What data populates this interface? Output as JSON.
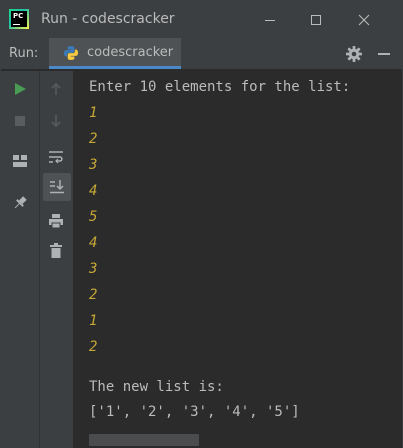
{
  "window": {
    "title": "Run - codescracker"
  },
  "run_panel": {
    "label": "Run:",
    "tab_label": "codescracker"
  },
  "console": {
    "prompt": "Enter 10 elements for the list:",
    "inputs": [
      "1",
      "2",
      "3",
      "4",
      "5",
      "4",
      "3",
      "2",
      "1",
      "2"
    ],
    "result_label": "The new list is:",
    "result_value": "['1', '2', '3', '4', '5']"
  },
  "colors": {
    "background": "#2b2b2b",
    "panel": "#3c3f41",
    "text": "#bbbbbb",
    "input_text": "#c7a836",
    "run_green": "#499c54",
    "tab_underline": "#4a88c7"
  },
  "icons": {
    "app": "pycharm-logo-icon",
    "python": "python-icon",
    "settings": "gear-icon",
    "rerun": "run-icon",
    "stop": "stop-icon",
    "up": "arrow-up-icon",
    "down": "arrow-down-icon",
    "wrap": "soft-wrap-icon",
    "scroll": "scroll-to-end-icon",
    "layout": "layout-icon",
    "pin": "pin-icon",
    "print": "print-icon",
    "trash": "trash-icon"
  }
}
